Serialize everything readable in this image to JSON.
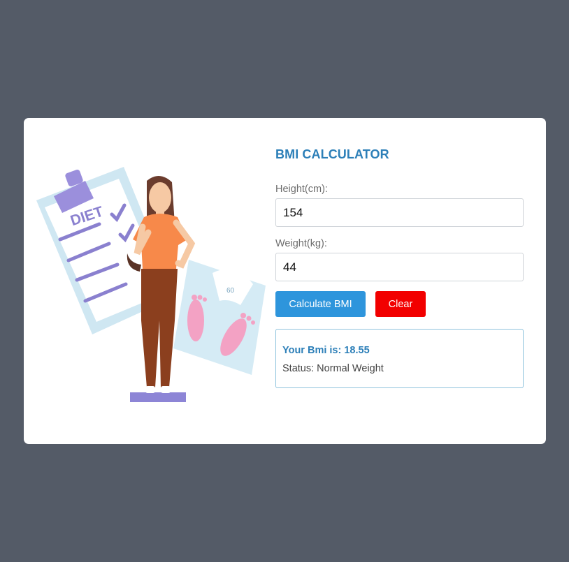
{
  "calculator": {
    "title": "BMI CALCULATOR",
    "height_label": "Height(cm):",
    "height_value": "154",
    "weight_label": "Weight(kg):",
    "weight_value": "44",
    "calculate_label": "Calculate BMI",
    "clear_label": "Clear"
  },
  "result": {
    "bmi_text": "Your Bmi is: 18.55",
    "status_text": "Status: Normal Weight"
  },
  "illustration": {
    "clipboard_text": "DIET",
    "scale_text": "60"
  },
  "colors": {
    "background": "#545b67",
    "accent": "#2c7fb8",
    "calculate_button": "#2e95dc",
    "clear_button": "#f20000"
  }
}
